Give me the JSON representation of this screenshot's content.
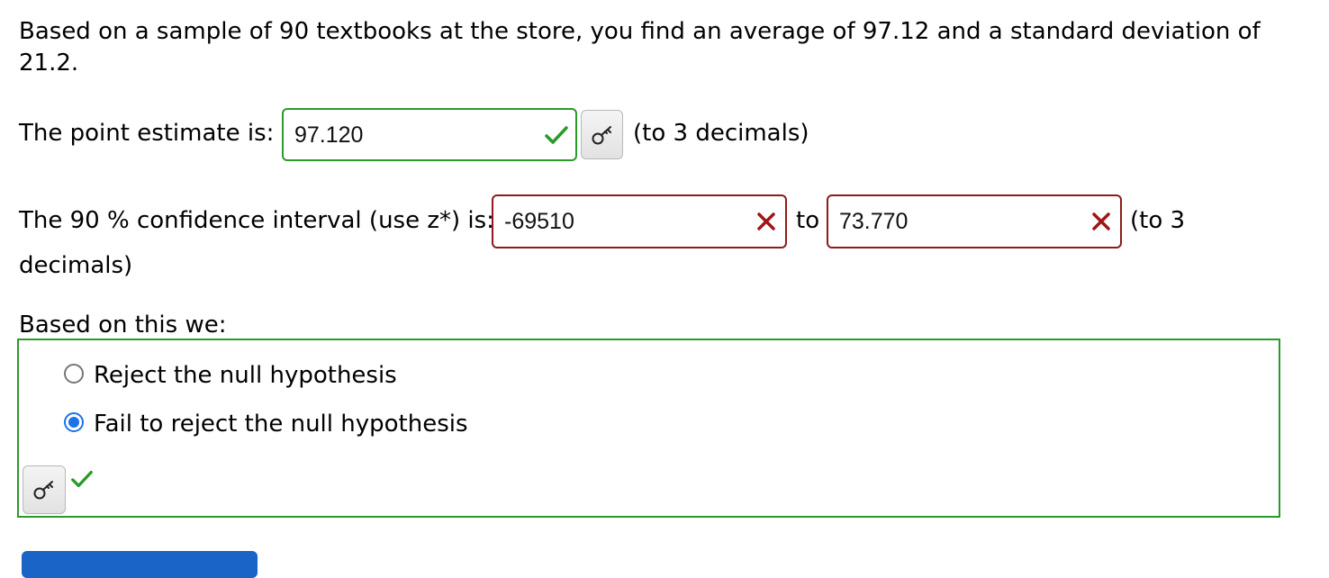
{
  "question": {
    "line1": "Based on a sample of 90 textbooks at the store, you find an average of 97.12 and a standard deviation of",
    "line2": "21.2."
  },
  "point_estimate": {
    "label": "The point estimate is:",
    "value": "97.120",
    "status": "correct",
    "suffix": "(to 3 decimals)"
  },
  "confidence_interval": {
    "label": "The 90 % confidence interval (use z*) is:",
    "lower_value": "-69510",
    "lower_status": "incorrect",
    "to_label": "to",
    "upper_value": "73.770",
    "upper_status": "incorrect",
    "suffix_line1": "(to 3",
    "suffix_line2": "decimals)"
  },
  "decision": {
    "label": "Based on this we:",
    "options": [
      {
        "label": "Reject the null hypothesis",
        "selected": false
      },
      {
        "label": "Fail to reject the null hypothesis",
        "selected": true
      }
    ],
    "status": "correct"
  },
  "colors": {
    "correct": "#2a9a2a",
    "incorrect": "#8e1b1b",
    "accent": "#1a73e8"
  }
}
